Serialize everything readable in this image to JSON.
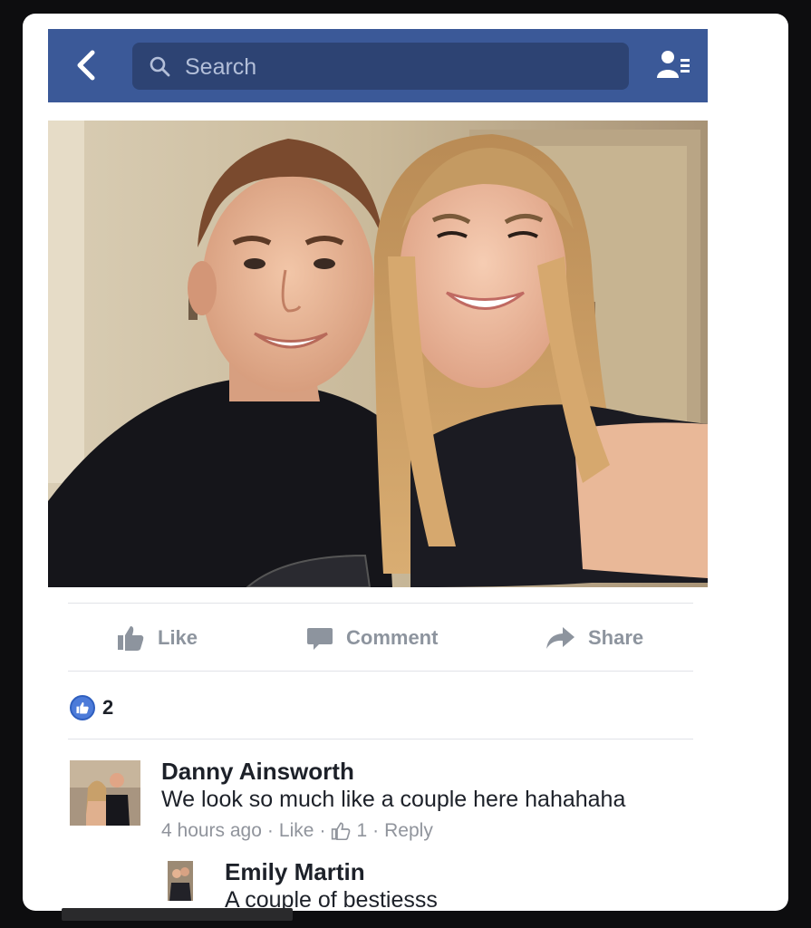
{
  "navbar": {
    "search_placeholder": "Search",
    "brand_color": "#3b5998"
  },
  "post": {
    "actions": {
      "like": "Like",
      "comment": "Comment",
      "share": "Share"
    },
    "like_count": "2"
  },
  "comments": [
    {
      "author": "Danny Ainsworth",
      "text": "We look so much like a couple here hahahaha",
      "time": "4 hours ago",
      "like_label": "Like",
      "reaction_count": "1",
      "reply_label": "Reply",
      "separator": "·"
    }
  ],
  "replies": [
    {
      "author": "Emily Martin",
      "text": "A couple of bestiesss"
    }
  ]
}
